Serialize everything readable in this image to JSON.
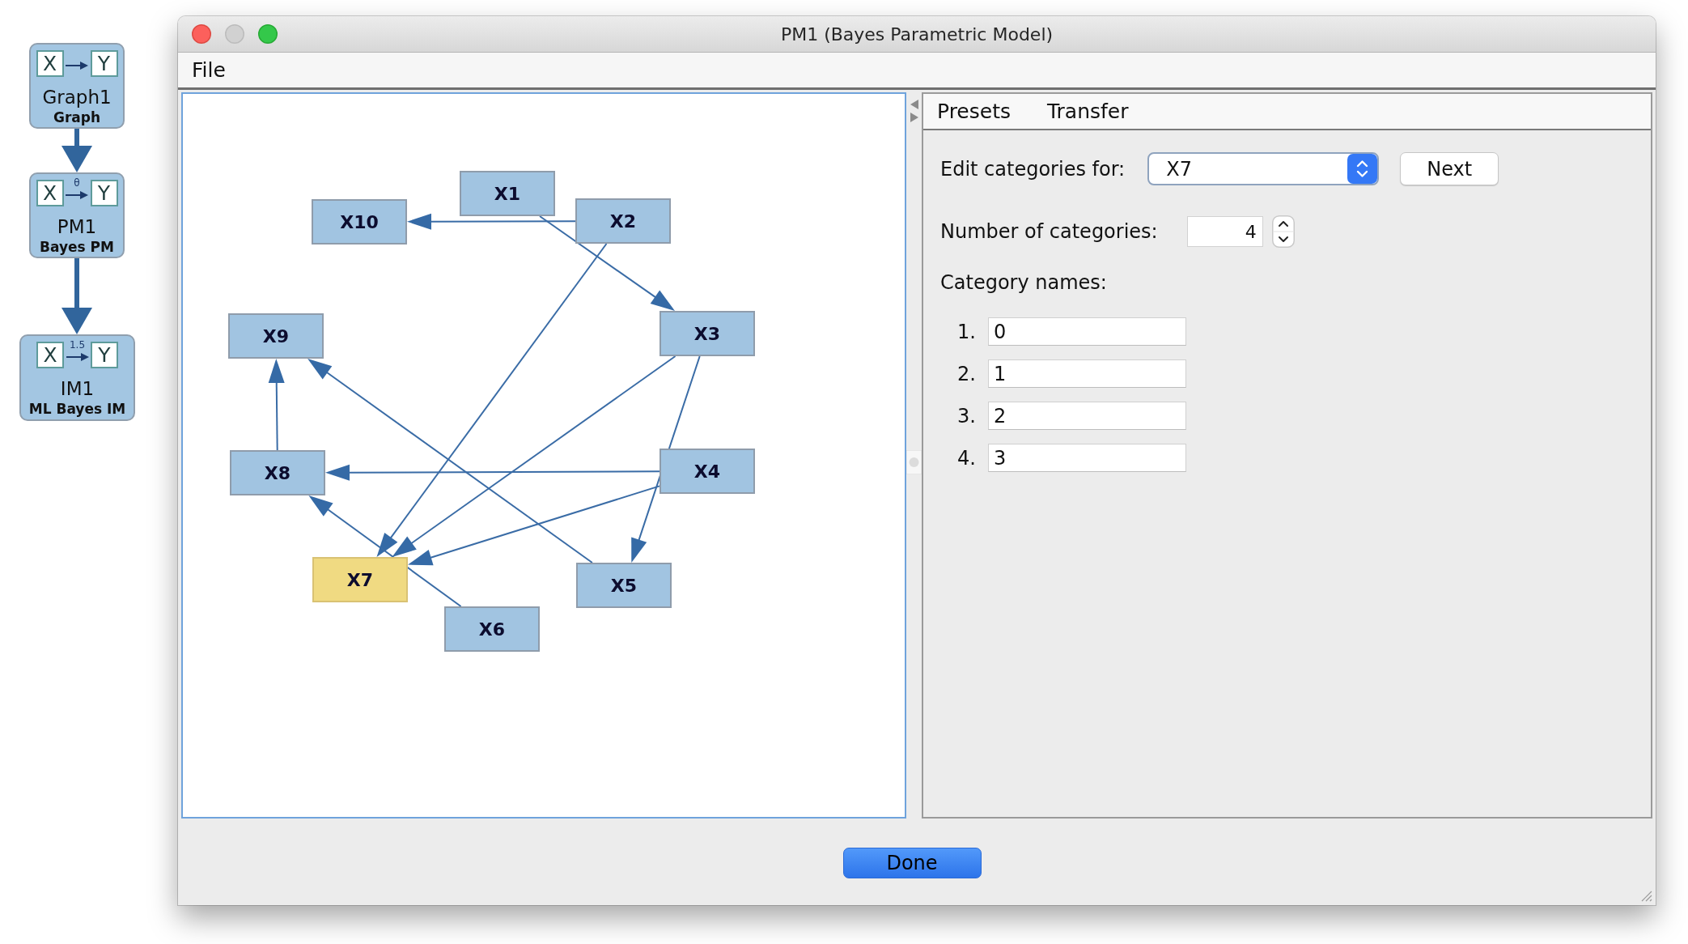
{
  "session_nodes": [
    {
      "name": "Graph1",
      "type": "Graph",
      "icon": {
        "left": "X",
        "right": "Y"
      }
    },
    {
      "name": "PM1",
      "type": "Bayes PM",
      "icon": {
        "left": "X",
        "right": "Y",
        "arrow_label": "θ"
      }
    },
    {
      "name": "IM1",
      "type": "ML Bayes IM",
      "icon": {
        "left": "X",
        "right": "Y",
        "arrow_label": "1.5"
      }
    }
  ],
  "window": {
    "title": "PM1 (Bayes Parametric Model)",
    "controls": [
      {
        "kind": "close",
        "disabled": false
      },
      {
        "kind": "minimize",
        "disabled": true
      },
      {
        "kind": "zoom",
        "disabled": false
      }
    ]
  },
  "menu": [
    "File"
  ],
  "graph": {
    "nodes": [
      {
        "label": "X1",
        "selected": false
      },
      {
        "label": "X2",
        "selected": false
      },
      {
        "label": "X3",
        "selected": false
      },
      {
        "label": "X4",
        "selected": false
      },
      {
        "label": "X5",
        "selected": false
      },
      {
        "label": "X6",
        "selected": false
      },
      {
        "label": "X7",
        "selected": true
      },
      {
        "label": "X8",
        "selected": false
      },
      {
        "label": "X9",
        "selected": false
      },
      {
        "label": "X10",
        "selected": false
      }
    ]
  },
  "editor": {
    "menu": [
      "Presets",
      "Transfer"
    ],
    "variable_label": "Edit categories for:",
    "variable": "X7",
    "next_button": {
      "label": "Next",
      "default": false
    },
    "count_label": "Number of categories:",
    "count": "4",
    "names_label": "Category names:",
    "categories": [
      {
        "number": "1.",
        "value": "0"
      },
      {
        "number": "2.",
        "value": "1"
      },
      {
        "number": "3.",
        "value": "2"
      },
      {
        "number": "4.",
        "value": "3"
      }
    ]
  },
  "footer_buttons": [
    {
      "label": "Done",
      "default": true
    }
  ]
}
